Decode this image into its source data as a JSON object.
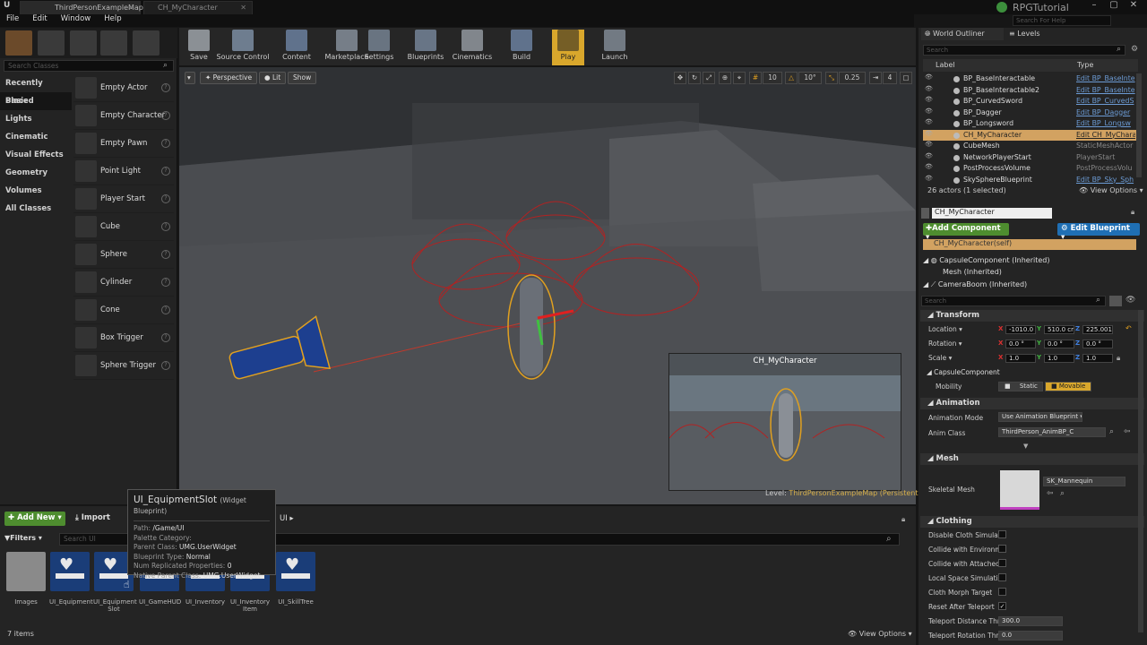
{
  "tabs": [
    {
      "label": "ThirdPersonExampleMap"
    },
    {
      "label": "CH_MyCharacter"
    }
  ],
  "brand": "RPGTutorial",
  "help_search_placeholder": "Search For Help",
  "menu": [
    "File",
    "Edit",
    "Window",
    "Help"
  ],
  "modes": {
    "search_placeholder": "Search Classes",
    "categories": [
      "Recently Placed",
      "Basic",
      "Lights",
      "Cinematic",
      "Visual Effects",
      "Geometry",
      "Volumes",
      "All Classes"
    ],
    "items": [
      "Empty Actor",
      "Empty Character",
      "Empty Pawn",
      "Point Light",
      "Player Start",
      "Cube",
      "Sphere",
      "Cylinder",
      "Cone",
      "Box Trigger",
      "Sphere Trigger"
    ]
  },
  "toolbar": [
    "Save",
    "Source Control",
    "Content",
    "Marketplace",
    "Settings",
    "Blueprints",
    "Cinematics",
    "Build",
    "Play",
    "Launch"
  ],
  "viewport": {
    "perspective": "Perspective",
    "lit": "Lit",
    "show": "Show",
    "snap_values": [
      "10",
      "10°",
      "0.25",
      "4"
    ],
    "level_prefix": "Level:",
    "level_name": "ThirdPersonExampleMap (Persistent)",
    "preview_title": "CH_MyCharacter"
  },
  "content_browser": {
    "add_new": "Add New",
    "import": "Import",
    "breadcrumb": "UI",
    "filters": "Filters",
    "search_placeholder": "Search UI",
    "assets": [
      "Images",
      "UI_Equipment",
      "UI_Equipment Slot",
      "UI_GameHUD",
      "UI_Inventory",
      "UI_Inventory Item",
      "UI_SkillTree"
    ],
    "item_count": "7 items",
    "view_options": "View Options"
  },
  "tooltip": {
    "title": "UI_EquipmentSlot",
    "subtitle": "(Widget Blueprint)",
    "rows": [
      {
        "k": "Path:",
        "v": "/Game/UI"
      },
      {
        "k": "Palette Category:",
        "v": ""
      },
      {
        "k": "Parent Class:",
        "v": "UMG.UserWidget"
      },
      {
        "k": "Blueprint Type:",
        "v": "Normal"
      },
      {
        "k": "Num Replicated Properties:",
        "v": "0"
      },
      {
        "k": "Native Parent Class:",
        "v": "UMG.UserWidget"
      }
    ]
  },
  "outliner": {
    "tab_outliner": "World Outliner",
    "tab_levels": "Levels",
    "search_placeholder": "Search",
    "col_label": "Label",
    "col_type": "Type",
    "rows": [
      {
        "label": "BP_BaseInteractable",
        "type": "Edit BP_BaseInte"
      },
      {
        "label": "BP_BaseInteractable2",
        "type": "Edit BP_BaseInte"
      },
      {
        "label": "BP_CurvedSword",
        "type": "Edit BP_CurvedS"
      },
      {
        "label": "BP_Dagger",
        "type": "Edit BP_Dagger"
      },
      {
        "label": "BP_Longsword",
        "type": "Edit BP_Longsw"
      },
      {
        "label": "CH_MyCharacter",
        "type": "Edit CH_MyCharac"
      },
      {
        "label": "CubeMesh",
        "type": "StaticMeshActor"
      },
      {
        "label": "NetworkPlayerStart",
        "type": "PlayerStart"
      },
      {
        "label": "PostProcessVolume",
        "type": "PostProcessVolu"
      },
      {
        "label": "SkySphereBlueprint",
        "type": "Edit BP_Sky_Sph"
      }
    ],
    "count": "26 actors (1 selected)",
    "view_options": "View Options"
  },
  "details": {
    "name": "CH_MyCharacter",
    "add_component": "Add Component",
    "edit_blueprint": "Edit Blueprint",
    "self_row": "CH_MyCharacter(self)",
    "components": [
      "CapsuleComponent (Inherited)",
      "Mesh (Inherited)",
      "CameraBoom (Inherited)"
    ],
    "search_placeholder": "Search",
    "transform": {
      "header": "Transform",
      "location_label": "Location",
      "location": [
        "-1010.0",
        "510.0 cr",
        "225.001"
      ],
      "rotation_label": "Rotation",
      "rotation": [
        "0.0 °",
        "0.0 °",
        "0.0 °"
      ],
      "scale_label": "Scale",
      "scale": [
        "1.0",
        "1.0",
        "1.0"
      ]
    },
    "capsule_header": "CapsuleComponent",
    "mobility_label": "Mobility",
    "mobility_static": "Static",
    "mobility_movable": "Movable",
    "animation_header": "Animation",
    "anim_mode_label": "Animation Mode",
    "anim_mode": "Use Animation Blueprint",
    "anim_class_label": "Anim Class",
    "anim_class": "ThirdPerson_AnimBP_C",
    "mesh_header": "Mesh",
    "skeletal_mesh_label": "Skeletal Mesh",
    "skeletal_mesh": "SK_Mannequin",
    "clothing_header": "Clothing",
    "clothing": [
      {
        "label": "Disable Cloth Simulat",
        "checked": false
      },
      {
        "label": "Collide with Environm",
        "checked": false
      },
      {
        "label": "Collide with Attached",
        "checked": false
      },
      {
        "label": "Local Space Simulatic",
        "checked": false
      },
      {
        "label": "Cloth Morph Target",
        "checked": false
      },
      {
        "label": "Reset After Teleport",
        "checked": true
      }
    ],
    "teleport_distance_label": "Teleport Distance Thr",
    "teleport_distance": "300.0",
    "teleport_rotation_label": "Teleport Rotation Thr",
    "teleport_rotation": "0.0"
  },
  "colors": {
    "accent_green": "#4e8d2f",
    "accent_blue": "#1f6fb4",
    "selection": "#d2a261",
    "play": "#d9a72c"
  }
}
